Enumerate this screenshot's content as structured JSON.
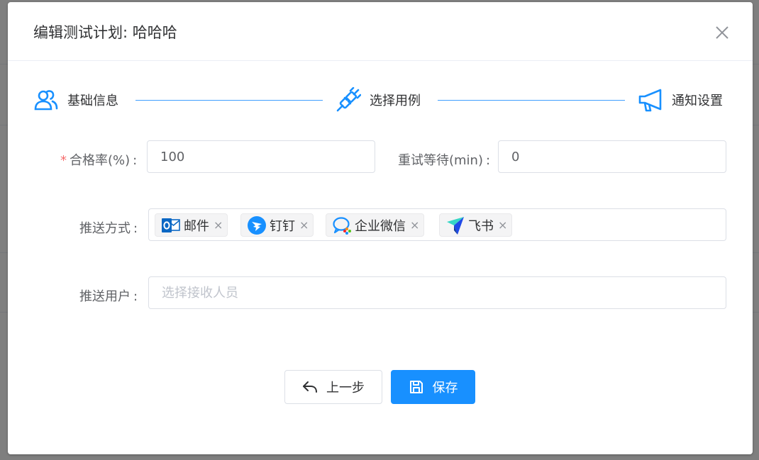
{
  "dialog": {
    "title": "编辑测试计划: 哈哈哈",
    "close_icon": "close-icon"
  },
  "steps": [
    {
      "label": "基础信息",
      "icon": "users-icon"
    },
    {
      "label": "选择用例",
      "icon": "plug-icon"
    },
    {
      "label": "通知设置",
      "icon": "megaphone-icon"
    }
  ],
  "form": {
    "pass_rate": {
      "label": "合格率(%)",
      "required_mark": "*",
      "colon": ":",
      "value": "100"
    },
    "retry_wait": {
      "label": "重试等待(min)",
      "colon": ":",
      "value": "0"
    },
    "push_method": {
      "label": "推送方式",
      "colon": ":",
      "tags": [
        {
          "label": "邮件",
          "icon": "outlook-mail-icon"
        },
        {
          "label": "钉钉",
          "icon": "dingtalk-icon"
        },
        {
          "label": "企业微信",
          "icon": "wecom-icon"
        },
        {
          "label": "飞书",
          "icon": "feishu-icon"
        }
      ],
      "tag_close": "×"
    },
    "push_user": {
      "label": "推送用户",
      "colon": ":",
      "placeholder": "选择接收人员"
    }
  },
  "footer": {
    "prev_label": "上一步",
    "save_label": "保存"
  },
  "colors": {
    "primary": "#1890ff",
    "step_line": "#409eff",
    "required": "#f56c6c"
  }
}
